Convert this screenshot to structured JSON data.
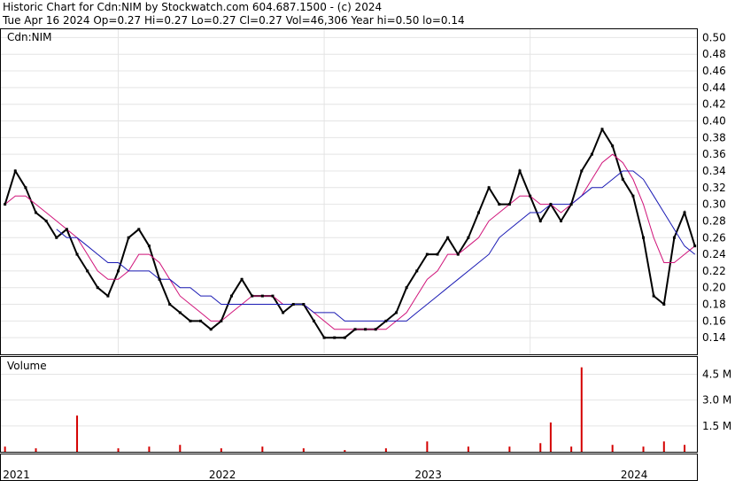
{
  "header": {
    "line1": "Historic Chart for Cdn:NIM by Stockwatch.com 604.687.1500 - (c) 2024",
    "line2": "Tue Apr 16 2024  Op=0.27  Hi=0.27  Lo=0.27  Cl=0.27  Vol=46,306  Year hi=0.50  lo=0.14"
  },
  "chart_data": [
    {
      "type": "line",
      "label": "Cdn:NIM",
      "ylim": [
        0.12,
        0.51
      ],
      "y_ticks": [
        "0.50",
        "0.48",
        "0.46",
        "0.44",
        "0.42",
        "0.40",
        "0.38",
        "0.36",
        "0.34",
        "0.32",
        "0.30",
        "0.28",
        "0.26",
        "0.24",
        "0.22",
        "0.20",
        "0.18",
        "0.16",
        "0.14"
      ],
      "grid": true,
      "x": [
        2020.95,
        2021.0,
        2021.05,
        2021.1,
        2021.15,
        2021.2,
        2021.25,
        2021.3,
        2021.35,
        2021.4,
        2021.45,
        2021.5,
        2021.55,
        2021.6,
        2021.65,
        2021.7,
        2021.75,
        2021.8,
        2021.85,
        2021.9,
        2021.95,
        2022.0,
        2022.05,
        2022.1,
        2022.15,
        2022.2,
        2022.25,
        2022.3,
        2022.35,
        2022.4,
        2022.45,
        2022.5,
        2022.55,
        2022.6,
        2022.65,
        2022.7,
        2022.75,
        2022.8,
        2022.85,
        2022.9,
        2022.95,
        2023.0,
        2023.05,
        2023.1,
        2023.15,
        2023.2,
        2023.25,
        2023.3,
        2023.35,
        2023.4,
        2023.45,
        2023.5,
        2023.55,
        2023.6,
        2023.65,
        2023.7,
        2023.75,
        2023.8,
        2023.85,
        2023.9,
        2023.95,
        2024.0,
        2024.05,
        2024.1,
        2024.15,
        2024.2,
        2024.25,
        2024.3
      ],
      "series": [
        {
          "values": [
            0.3,
            0.34,
            0.32,
            0.29,
            0.28,
            0.26,
            0.27,
            0.24,
            0.22,
            0.2,
            0.19,
            0.22,
            0.26,
            0.27,
            0.25,
            0.21,
            0.18,
            0.17,
            0.16,
            0.16,
            0.15,
            0.16,
            0.19,
            0.21,
            0.19,
            0.19,
            0.19,
            0.17,
            0.18,
            0.18,
            0.16,
            0.14,
            0.14,
            0.14,
            0.15,
            0.15,
            0.15,
            0.16,
            0.17,
            0.2,
            0.22,
            0.24,
            0.24,
            0.26,
            0.24,
            0.26,
            0.29,
            0.32,
            0.3,
            0.3,
            0.34,
            0.31,
            0.28,
            0.3,
            0.28,
            0.3,
            0.34,
            0.36,
            0.39,
            0.37,
            0.33,
            0.31,
            0.26,
            0.19,
            0.18,
            0.26,
            0.29,
            0.25
          ]
        },
        {
          "values": [
            0.3,
            0.31,
            0.31,
            0.3,
            0.29,
            0.28,
            0.27,
            0.26,
            0.24,
            0.22,
            0.21,
            0.21,
            0.22,
            0.24,
            0.24,
            0.23,
            0.21,
            0.19,
            0.18,
            0.17,
            0.16,
            0.16,
            0.17,
            0.18,
            0.19,
            0.19,
            0.19,
            0.18,
            0.18,
            0.18,
            0.17,
            0.16,
            0.15,
            0.15,
            0.15,
            0.15,
            0.15,
            0.15,
            0.16,
            0.17,
            0.19,
            0.21,
            0.22,
            0.24,
            0.24,
            0.25,
            0.26,
            0.28,
            0.29,
            0.3,
            0.31,
            0.31,
            0.3,
            0.3,
            0.29,
            0.3,
            0.31,
            0.33,
            0.35,
            0.36,
            0.35,
            0.33,
            0.3,
            0.26,
            0.23,
            0.23,
            0.24,
            0.25
          ]
        },
        {
          "values": [
            null,
            null,
            null,
            null,
            null,
            0.27,
            0.26,
            0.26,
            0.25,
            0.24,
            0.23,
            0.23,
            0.22,
            0.22,
            0.22,
            0.21,
            0.21,
            0.2,
            0.2,
            0.19,
            0.19,
            0.18,
            0.18,
            0.18,
            0.18,
            0.18,
            0.18,
            0.18,
            0.18,
            0.18,
            0.17,
            0.17,
            0.17,
            0.16,
            0.16,
            0.16,
            0.16,
            0.16,
            0.16,
            0.16,
            0.17,
            0.18,
            0.19,
            0.2,
            0.21,
            0.22,
            0.23,
            0.24,
            0.26,
            0.27,
            0.28,
            0.29,
            0.29,
            0.3,
            0.3,
            0.3,
            0.31,
            0.32,
            0.32,
            0.33,
            0.34,
            0.34,
            0.33,
            0.31,
            0.29,
            0.27,
            0.25,
            0.24
          ]
        }
      ]
    },
    {
      "type": "bar",
      "label": "Volume",
      "y_ticks": [
        "4.5 M",
        "3.0 M",
        "1.5 M"
      ],
      "ylim": [
        0,
        5.5
      ],
      "x": [
        2020.95,
        2021.1,
        2021.3,
        2021.5,
        2021.65,
        2021.8,
        2022.0,
        2022.2,
        2022.4,
        2022.6,
        2022.8,
        2023.0,
        2023.2,
        2023.4,
        2023.55,
        2023.6,
        2023.7,
        2023.75,
        2023.9,
        2024.05,
        2024.15,
        2024.25
      ],
      "values": [
        0.3,
        0.2,
        2.1,
        0.2,
        0.3,
        0.4,
        0.2,
        0.3,
        0.2,
        0.1,
        0.2,
        0.6,
        0.3,
        0.3,
        0.5,
        1.7,
        0.3,
        4.9,
        0.4,
        0.3,
        0.6,
        0.4
      ]
    }
  ],
  "x_axis": {
    "labels": [
      {
        "text": "2021",
        "x": 2021.0
      },
      {
        "text": "2022",
        "x": 2022.0
      },
      {
        "text": "2023",
        "x": 2023.0
      },
      {
        "text": "2024",
        "x": 2024.0
      }
    ],
    "dividers": [
      2021.5,
      2022.5,
      2023.5
    ]
  }
}
